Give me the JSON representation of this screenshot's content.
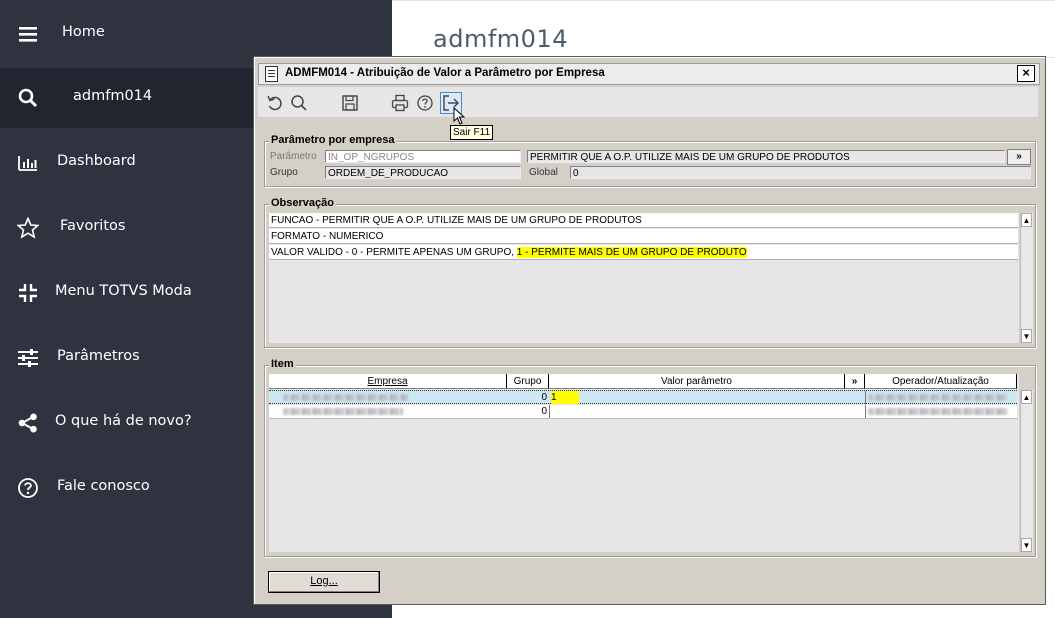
{
  "sidebar": {
    "items": [
      {
        "label": "Home",
        "icon": "hamburger-icon"
      },
      {
        "label": "admfm014",
        "icon": "search-icon"
      },
      {
        "label": "Dashboard",
        "icon": "bar-chart-icon"
      },
      {
        "label": "Favoritos",
        "icon": "star-icon"
      },
      {
        "label": "Menu TOTVS Moda",
        "icon": "compress-icon"
      },
      {
        "label": "Parâmetros",
        "icon": "sliders-icon"
      },
      {
        "label": "O que há de novo?",
        "icon": "share-icon"
      },
      {
        "label": "Fale conosco",
        "icon": "help-circle-icon"
      }
    ]
  },
  "page": {
    "title": "admfm014"
  },
  "dialog": {
    "title": "ADMFM014 - Atribuição de Valor a Parâmetro por Empresa",
    "close": "×",
    "tooltip": "Sair F11",
    "param_group": {
      "title": "Parâmetro por empresa",
      "parametro_label": "Parâmetro",
      "parametro_value": "IN_OP_NGRUPOS",
      "descricao_value": "PERMITIR QUE A O.P. UTILIZE MAIS DE UM GRUPO DE PRODUTOS",
      "more_button": "»",
      "grupo_label": "Grupo",
      "grupo_value": "ORDEM_DE_PRODUCAO",
      "global_label": "Global",
      "global_value": "0"
    },
    "observacao": {
      "title": "Observação",
      "line1": "FUNCAO - PERMITIR QUE A O.P. UTILIZE MAIS DE UM GRUPO DE PRODUTOS",
      "line2": "FORMATO - NUMERICO",
      "line3a": "VALOR VALIDO -  0 - PERMITE APENAS UM GRUPO, ",
      "line3b": "1 - PERMITE MAIS DE UM GRUPO DE PRODUTO"
    },
    "item": {
      "title": "Item",
      "columns": [
        "Empresa",
        "Grupo",
        "Valor parâmetro",
        "»",
        "Operador/Atualização"
      ],
      "rows": [
        {
          "grupo": "0",
          "valor": "1"
        },
        {
          "grupo": "0",
          "valor": ""
        }
      ]
    },
    "log_button": "Log..."
  }
}
